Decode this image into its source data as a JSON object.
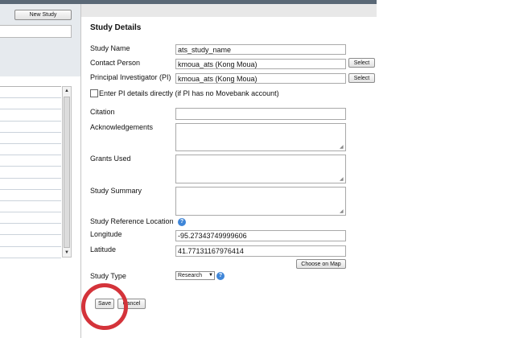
{
  "left_panel": {
    "new_study_label": "New Study",
    "search_value": "",
    "list_rows": [
      "",
      "",
      "",
      "",
      "",
      "",
      "",
      "",
      "",
      "",
      "",
      "",
      "",
      "",
      ""
    ]
  },
  "form": {
    "title": "Study Details",
    "study_name": {
      "label": "Study Name",
      "value": "ats_study_name"
    },
    "contact_person": {
      "label": "Contact Person",
      "value": "kmoua_ats (Kong Moua)",
      "button": "Select"
    },
    "principal_investigator": {
      "label": "Principal Investigator (PI)",
      "value": "kmoua_ats (Kong Moua)",
      "button": "Select"
    },
    "pi_direct_checkbox": {
      "label": "Enter PI details directly (if PI has no Movebank account)",
      "checked": false
    },
    "citation": {
      "label": "Citation",
      "value": ""
    },
    "acknowledgements": {
      "label": "Acknowledgements",
      "value": ""
    },
    "grants_used": {
      "label": "Grants Used",
      "value": ""
    },
    "study_summary": {
      "label": "Study Summary",
      "value": ""
    },
    "reference_location": {
      "label": "Study Reference Location"
    },
    "longitude": {
      "label": "Longitude",
      "value": "-95.27343749999606"
    },
    "latitude": {
      "label": "Latitude",
      "value": "41.77131167976414"
    },
    "choose_on_map": "Choose on Map",
    "study_type": {
      "label": "Study Type",
      "selected": "Research"
    },
    "save_label": "Save",
    "cancel_label": "Cancel"
  },
  "icons": {
    "help": "question-circle-icon",
    "resize_grip": "resize-grip-icon"
  },
  "colors": {
    "help_icon": "#3f86d8",
    "highlight_ring": "#d4333a",
    "top_bar": "#5a6876"
  }
}
